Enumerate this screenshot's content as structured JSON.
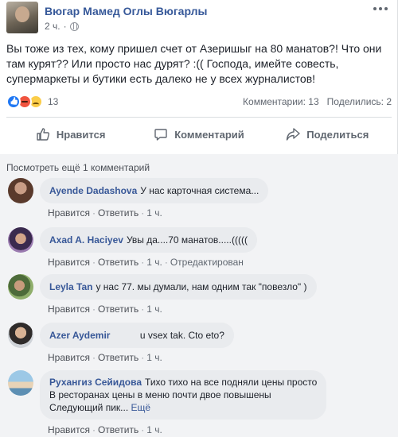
{
  "post": {
    "author": "Вюгар Мамед Оглы Вюгарлы",
    "time": "2 ч.",
    "text": "Вы тоже из тех, кому пришел счет от Азеришыг на 80 манатов?! Что они там курят?? Или просто нас дурят? :(( Господа, имейте совесть, супермаркеты и бутики есть далеко не у всех журналистов!",
    "reaction_count": "13",
    "comments_count_text": "Комментарии: 13",
    "shares_count_text": "Поделились: 2",
    "reaction_icons": [
      "like-icon",
      "angry-icon",
      "sad-icon"
    ]
  },
  "actions": {
    "like": "Нравится",
    "comment": "Комментарий",
    "share": "Поделиться"
  },
  "comments_section": {
    "view_more": "Посмотреть ещё 1 комментарий",
    "labels": {
      "like": "Нравится",
      "reply": "Ответить",
      "edited": "Отредактирован",
      "more": "Ещё"
    },
    "items": [
      {
        "name": "Ayende Dadashova",
        "text": "У нас карточная система...",
        "time": "1 ч.",
        "edited": false
      },
      {
        "name": "Axad A. Haciyev",
        "text": "Увы да....70 манатов.....(((((",
        "time": "1 ч.",
        "edited": true
      },
      {
        "name": "Leyla Tan",
        "text": "у нас 77. мы думали, нам одним так \"повезло\" )",
        "time": "1 ч.",
        "edited": false
      },
      {
        "name": "Azer Aydemir",
        "text": "u vsex tak. Cto eto?",
        "time": "1 ч.",
        "edited": false
      },
      {
        "name": "Рухангиз Сейидова",
        "text_lines": [
          "Тихо тихо на все подняли цены просто",
          "В ресторанах цены в меню почти двое повышены",
          "Следующий пик..."
        ],
        "time": "1 ч.",
        "edited": false
      }
    ]
  },
  "colors": {
    "link_blue": "#365899",
    "meta_gray": "#616770",
    "bubble_bg": "#e9ebee",
    "comments_bg": "#f2f3f5"
  }
}
